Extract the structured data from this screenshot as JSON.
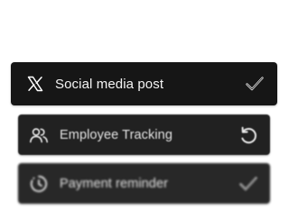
{
  "tasks": [
    {
      "label": "Social media post",
      "leading_icon": "x-logo-icon",
      "status_icon": "check-icon"
    },
    {
      "label": "Employee Tracking",
      "leading_icon": "users-icon",
      "status_icon": "refresh-icon"
    },
    {
      "label": "Payment reminder",
      "leading_icon": "clock-icon",
      "status_icon": "check-icon"
    }
  ],
  "colors": {
    "card_background": "#161616",
    "text": "#ffffff",
    "page_background": "#ffffff"
  }
}
